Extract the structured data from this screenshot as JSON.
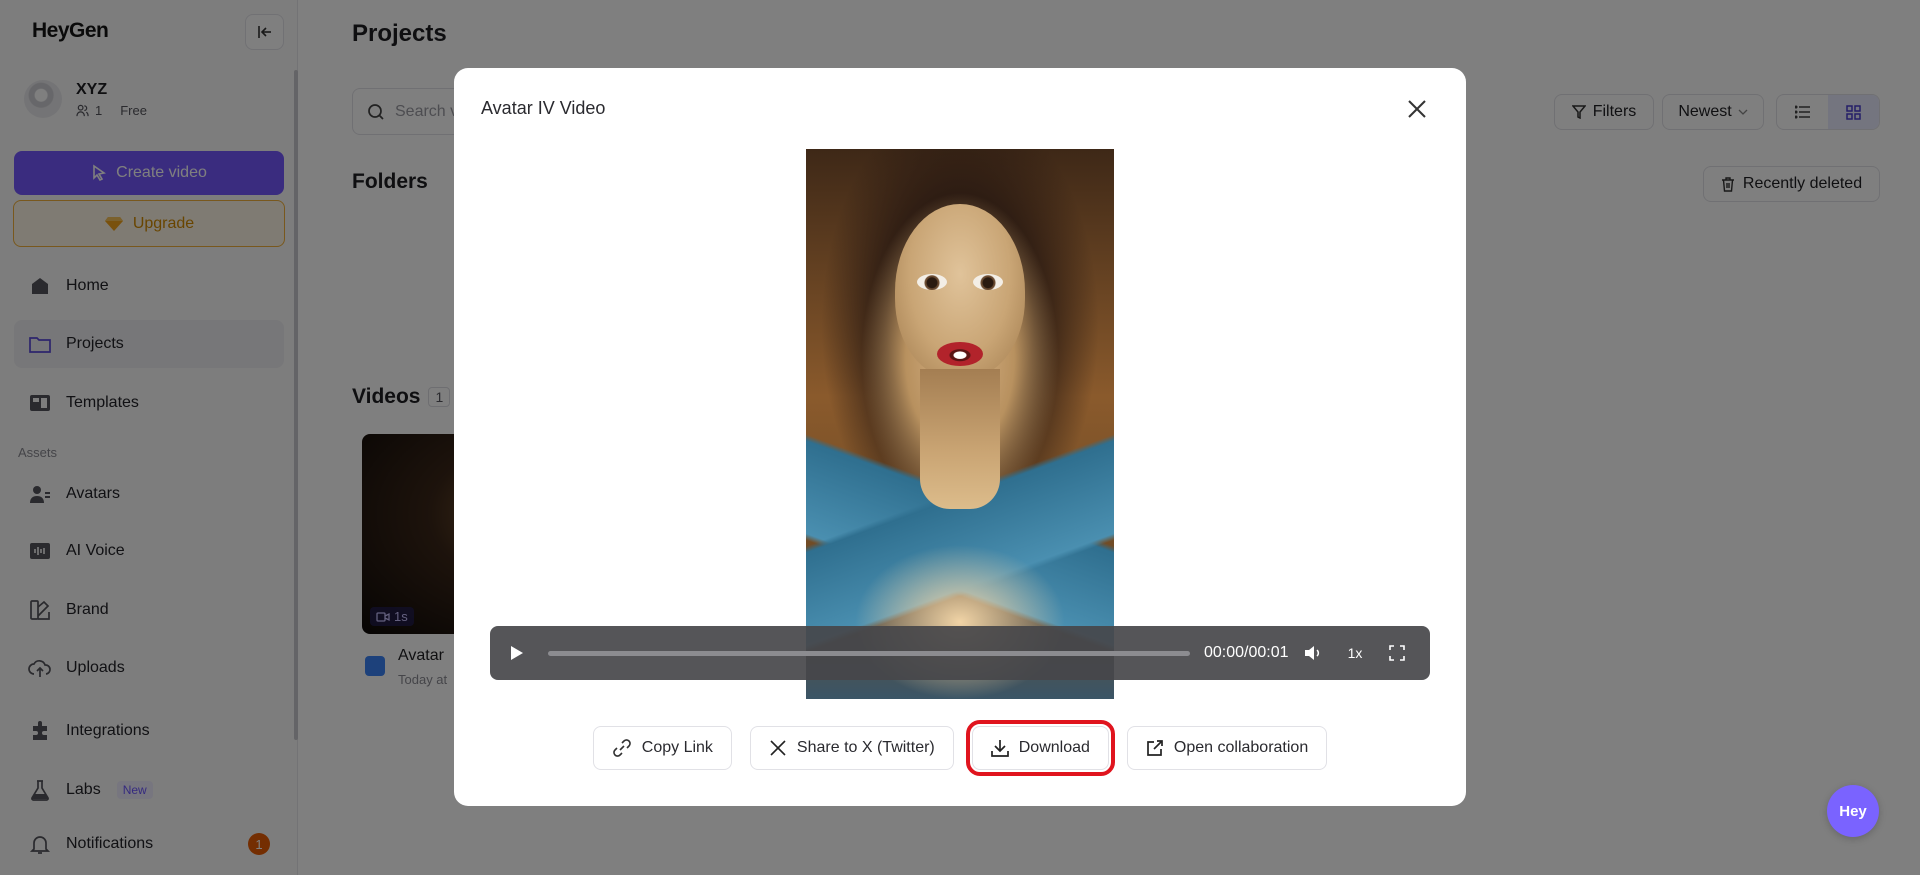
{
  "app": {
    "logo": "HeyGen"
  },
  "sidebar": {
    "workspace": {
      "name": "XYZ",
      "members": "1",
      "plan": "Free"
    },
    "create_label": "Create video",
    "upgrade_label": "Upgrade",
    "assets_label": "Assets",
    "items": [
      {
        "label": "Home",
        "icon": "home-icon"
      },
      {
        "label": "Projects",
        "icon": "folder-icon",
        "active": true
      },
      {
        "label": "Templates",
        "icon": "templates-icon"
      },
      {
        "label": "Avatars",
        "icon": "avatar-icon"
      },
      {
        "label": "AI Voice",
        "icon": "voice-icon"
      },
      {
        "label": "Brand",
        "icon": "brand-icon"
      },
      {
        "label": "Uploads",
        "icon": "upload-icon"
      },
      {
        "label": "Integrations",
        "icon": "integrations-icon"
      },
      {
        "label": "Labs",
        "icon": "flask-icon",
        "badge": "New"
      },
      {
        "label": "Notifications",
        "icon": "bell-icon",
        "count": "1"
      }
    ]
  },
  "main": {
    "title": "Projects",
    "search_placeholder": "Search v",
    "filters_label": "Filters",
    "sort_label": "Newest",
    "folders_title": "Folders",
    "recently_deleted_label": "Recently deleted",
    "videos_title": "Videos",
    "videos_count": "1",
    "video": {
      "name": "Avatar",
      "date": "Today at",
      "duration": "1s"
    }
  },
  "modal": {
    "title": "Avatar IV Video",
    "player": {
      "time": "00:00/00:01",
      "speed": "1x",
      "progress": 0
    },
    "actions": {
      "copy_link": "Copy Link",
      "share_x": "Share to X (Twitter)",
      "download": "Download",
      "open_collab": "Open collaboration"
    }
  },
  "fab_label": "Hey",
  "colors": {
    "brand": "#7559ff",
    "upgrade": "#f2b13b",
    "highlight": "#e0141e",
    "notification": "#e85d04"
  }
}
